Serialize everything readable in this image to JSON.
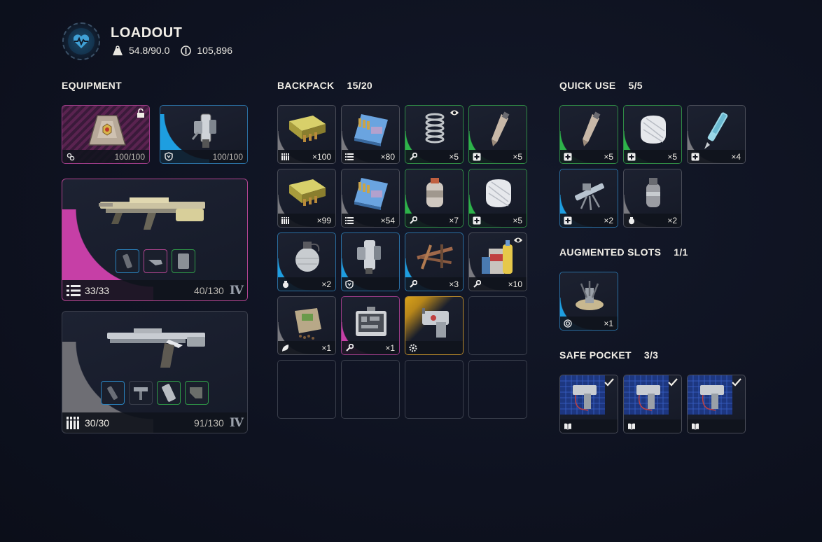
{
  "header": {
    "title": "LOADOUT",
    "weight": "54.8/90.0",
    "currency": "105,896"
  },
  "equipment": {
    "label": "EQUIPMENT",
    "augment_slot": {
      "value": "100/100",
      "rarity": "epic",
      "icon": "augment-icon"
    },
    "shield_slot": {
      "value": "100/100",
      "rarity": "rare",
      "icon": "shield-icon"
    },
    "weapon1": {
      "ammo": "33/33",
      "reserve": "40/130",
      "tier": "IV",
      "rarity": "epic"
    },
    "weapon2": {
      "ammo": "30/30",
      "reserve": "91/130",
      "tier": "IV",
      "rarity": "common"
    }
  },
  "backpack": {
    "label": "BACKPACK",
    "count": "15/20",
    "items": [
      {
        "name": "light-ammo",
        "qty": "×100",
        "rarity": "common",
        "type": "ammo-light-icon"
      },
      {
        "name": "medium-ammo",
        "qty": "×80",
        "rarity": "common",
        "type": "ammo-medium-icon"
      },
      {
        "name": "spring",
        "qty": "×5",
        "rarity": "uncommon",
        "type": "wrench-icon",
        "tracked": true
      },
      {
        "name": "adrenaline-shot",
        "qty": "×5",
        "rarity": "uncommon",
        "type": "medical-icon"
      },
      {
        "name": "light-ammo-2",
        "qty": "×99",
        "rarity": "common",
        "type": "ammo-light-icon"
      },
      {
        "name": "medium-ammo-2",
        "qty": "×54",
        "rarity": "common",
        "type": "ammo-medium-icon"
      },
      {
        "name": "canister",
        "qty": "×7",
        "rarity": "uncommon",
        "type": "wrench-icon"
      },
      {
        "name": "bandage",
        "qty": "×5",
        "rarity": "uncommon",
        "type": "medical-icon"
      },
      {
        "name": "grenade",
        "qty": "×2",
        "rarity": "rare",
        "type": "grenade-icon"
      },
      {
        "name": "shield-recharger",
        "qty": "",
        "rarity": "rare",
        "type": "shield-icon"
      },
      {
        "name": "scrap-parts",
        "qty": "×3",
        "rarity": "rare",
        "type": "wrench-icon"
      },
      {
        "name": "chemicals",
        "qty": "×10",
        "rarity": "common",
        "type": "wrench-icon",
        "tracked": true
      },
      {
        "name": "seeds",
        "qty": "×1",
        "rarity": "common",
        "type": "leaf-icon"
      },
      {
        "name": "toolkit",
        "qty": "×1",
        "rarity": "epic",
        "type": "wrench-icon"
      },
      {
        "name": "key-device",
        "qty": "",
        "rarity": "legendary",
        "type": "gear-icon"
      }
    ]
  },
  "quick_use": {
    "label": "QUICK USE",
    "count": "5/5",
    "items": [
      {
        "name": "adrenaline-shot",
        "qty": "×5",
        "rarity": "uncommon",
        "type": "medical-icon"
      },
      {
        "name": "bandage",
        "qty": "×5",
        "rarity": "uncommon",
        "type": "medical-icon"
      },
      {
        "name": "syringe",
        "qty": "×4",
        "rarity": "common",
        "type": "medical-icon"
      },
      {
        "name": "defibrillator",
        "qty": "×2",
        "rarity": "rare",
        "type": "medical-icon"
      },
      {
        "name": "smoke-grenade",
        "qty": "×2",
        "rarity": "common",
        "type": "grenade-icon"
      }
    ]
  },
  "augmented": {
    "label": "AUGMENTED SLOTS",
    "count": "1/1",
    "items": [
      {
        "name": "trap-device",
        "qty": "×1",
        "rarity": "rare",
        "type": "target-icon"
      }
    ]
  },
  "safe_pocket": {
    "label": "SAFE POCKET",
    "count": "3/3",
    "items": [
      {
        "name": "blueprint-1",
        "type": "book-icon"
      },
      {
        "name": "blueprint-2",
        "type": "book-icon"
      },
      {
        "name": "blueprint-3",
        "type": "book-icon"
      }
    ]
  },
  "colors": {
    "common": "#7a7a80",
    "uncommon": "#2db34a",
    "rare": "#1e9ee0",
    "epic": "#c63fa6",
    "legendary": "#d8a21a",
    "background": "#0f1321"
  }
}
